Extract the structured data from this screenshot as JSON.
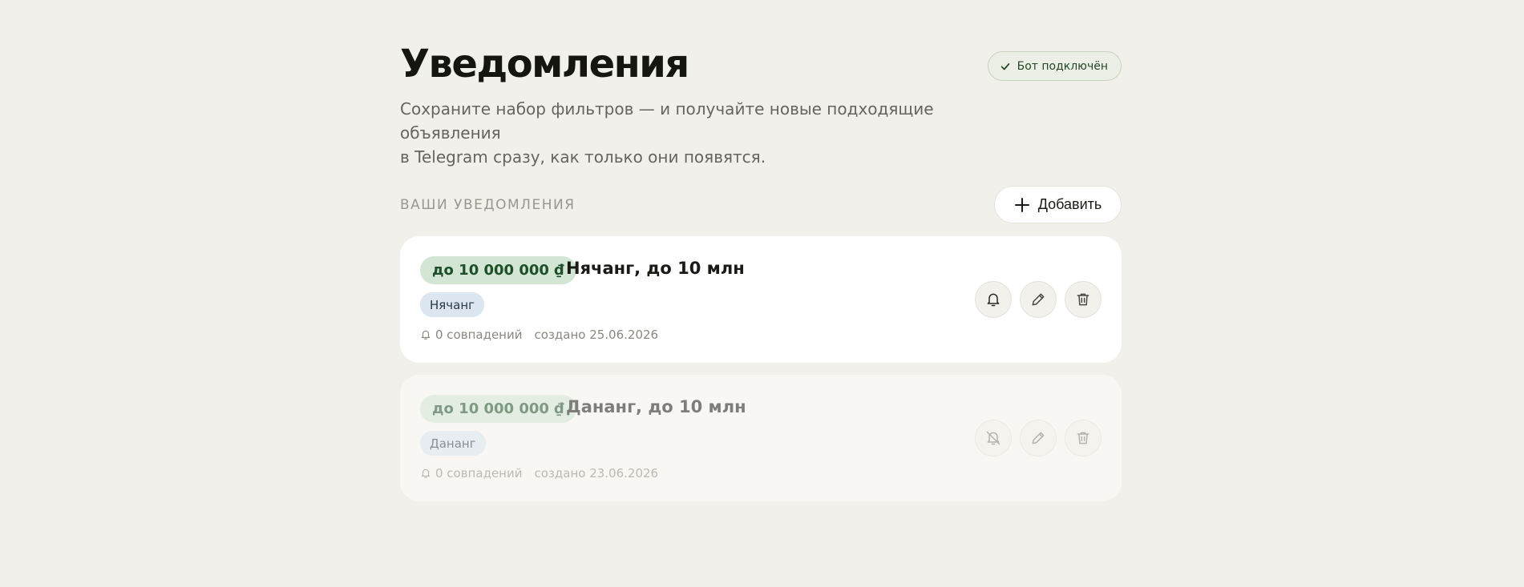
{
  "page": {
    "title": "Уведомления",
    "subtitle_line1": "Сохраните набор фильтров — и получайте новые подходящие объявления",
    "subtitle_line2": "в Telegram сразу, как только они появятся.",
    "bot_status": "Бот подключён"
  },
  "section": {
    "title": "ВАШИ УВЕДОМЛЕНИЯ",
    "add_label": "Добавить"
  },
  "notifications": [
    {
      "price": "до 10 000 000 ₫",
      "title": "Нячанг, до 10 млн",
      "city": "Нячанг",
      "matches": "0 совпадений",
      "created": "создано 25.06.2026",
      "state": "active",
      "toggle_icon": "bell-icon"
    },
    {
      "price": "до 10 000 000 ₫",
      "title": "Дананг, до 10 млн",
      "city": "Дананг",
      "matches": "0 совпадений",
      "created": "создано 23.06.2026",
      "state": "muted",
      "toggle_icon": "bell-off-icon"
    }
  ],
  "colors": {
    "background": "#f2f0ea",
    "card": "#ffffff",
    "price_chip": "#d3e6d3",
    "city_tag": "#dbe6f0",
    "bot_status_text": "#264626"
  }
}
